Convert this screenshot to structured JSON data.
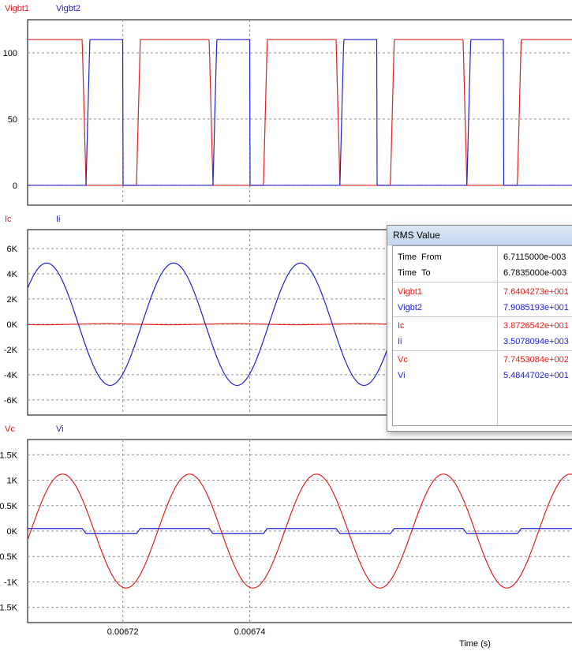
{
  "window": {
    "title": "RMS Value",
    "time_rows": [
      {
        "label_a": "Time",
        "label_b": "From",
        "value": "6.7115000e-003"
      },
      {
        "label_a": "Time",
        "label_b": "To",
        "value": "6.7835000e-003"
      }
    ],
    "groups": [
      [
        {
          "label": "Vigbt1",
          "value": "7.6404273e+001",
          "color": "#e02020"
        },
        {
          "label": "Vigbt2",
          "value": "7.9085193e+001",
          "color": "#2020d0"
        }
      ],
      [
        {
          "label": "Ic",
          "value": "3.8726542e+001",
          "color": "#e02020"
        },
        {
          "label": "Ii",
          "value": "3.5078094e+003",
          "color": "#2020d0"
        }
      ],
      [
        {
          "label": "Vc",
          "value": "7.7453084e+002",
          "color": "#e02020"
        },
        {
          "label": "Vi",
          "value": "5.4844702e+001",
          "color": "#2020d0"
        }
      ]
    ]
  },
  "chart_data": [
    {
      "type": "line",
      "xlim": [
        0.006705,
        0.006792
      ],
      "ylim": [
        -15,
        125
      ],
      "y_ticks": [
        0,
        50,
        100
      ],
      "y_tick_labels": [
        "0",
        "50",
        "100"
      ],
      "grid": true,
      "legend_position": "top-left",
      "series": [
        {
          "name": "Vigbt1",
          "color": "#e02020",
          "kind": "square",
          "low": 0,
          "high": 110,
          "period": 2e-05,
          "high_start": 2.75e-06,
          "high_end": 1.36e-05,
          "ramp": 6e-07
        },
        {
          "name": "Vigbt2",
          "color": "#2020d0",
          "kind": "square",
          "low": 0,
          "high": 110,
          "period": 2e-05,
          "high_start": 1.48e-05,
          "high_end": 2.27e-05,
          "ramp": 6e-07
        }
      ]
    },
    {
      "type": "line",
      "xlim": [
        0.006705,
        0.006792
      ],
      "ylim": [
        -7200,
        7500
      ],
      "y_ticks": [
        -6000,
        -4000,
        -2000,
        0,
        2000,
        4000,
        6000
      ],
      "y_tick_labels": [
        "-6K",
        "-4K",
        "-2K",
        "0K",
        "2K",
        "4K",
        "6K"
      ],
      "grid": true,
      "legend_position": "top-left",
      "series": [
        {
          "name": "Ic",
          "color": "#e02020",
          "kind": "sine",
          "amplitude": 40,
          "period": 2e-05,
          "phase_at": 0.0067125
        },
        {
          "name": "Ii",
          "color": "#2020d0",
          "kind": "sine",
          "amplitude": 4850,
          "period": 2e-05,
          "phase_at": 0.006703
        }
      ]
    },
    {
      "type": "line",
      "xlim": [
        0.006705,
        0.006792
      ],
      "ylim": [
        -1.8,
        1.8
      ],
      "y_ticks": [
        -1.5,
        -1,
        -0.5,
        0,
        0.5,
        1,
        1.5
      ],
      "y_tick_labels": [
        "-1.5K",
        "-1K",
        "-0.5K",
        "0K",
        "0.5K",
        "1K",
        "1.5K"
      ],
      "x_ticks": [
        0.00672,
        0.00674
      ],
      "x_tick_labels": [
        "0.00672",
        "0.00674"
      ],
      "xlabel": "Time (s)",
      "grid": true,
      "legend_position": "top-left",
      "series": [
        {
          "name": "Vc",
          "color": "#e02020",
          "kind": "sine",
          "amplitude": 1.12,
          "period": 2e-05,
          "phase_at": 0.0067055
        },
        {
          "name": "Vi",
          "color": "#2020d0",
          "kind": "square",
          "low": -0.05,
          "high": 0.05,
          "period": 2e-05,
          "high_start": 2.75e-06,
          "high_end": 1.36e-05,
          "ramp": 6e-07
        }
      ]
    }
  ]
}
